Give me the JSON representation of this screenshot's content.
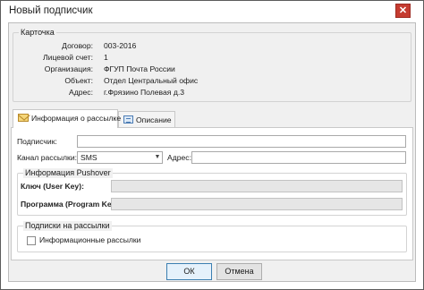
{
  "window": {
    "title": "Новый подписчик",
    "close_glyph": "✕"
  },
  "card": {
    "legend": "Карточка",
    "rows": [
      {
        "label": "Договор:",
        "value": "003-2016"
      },
      {
        "label": "Лицевой счет:",
        "value": "1"
      },
      {
        "label": "Организация:",
        "value": "ФГУП Почта России"
      },
      {
        "label": "Объект:",
        "value": "Отдел Центральный офис"
      },
      {
        "label": "Адрес:",
        "value": "г.Фрязино Полевая д.3"
      }
    ]
  },
  "tabs": [
    {
      "label": "Информация о рассылке",
      "icon": "envelope-icon",
      "active": true
    },
    {
      "label": "Описание",
      "icon": "description-icon",
      "active": false
    }
  ],
  "form": {
    "subscriber_label": "Подписчик:",
    "subscriber_value": "",
    "channel_label": "Канал рассылки:",
    "channel_value": "SMS",
    "address_label": "Адрес:",
    "address_value": ""
  },
  "pushover": {
    "legend": "Информация Pushover",
    "user_key_label": "Ключ (User Key):",
    "program_key_label": "Программа (Program Key):"
  },
  "subscriptions": {
    "legend": "Подписки на рассылки",
    "info_mailings_label": "Информационные рассылки",
    "info_mailings_checked": false
  },
  "buttons": {
    "ok": "ОК",
    "cancel": "Отмена"
  },
  "colors": {
    "close_button": "#c53b30",
    "default_button_border": "#3c7fb1",
    "panel_background": "#f0f0f0"
  }
}
